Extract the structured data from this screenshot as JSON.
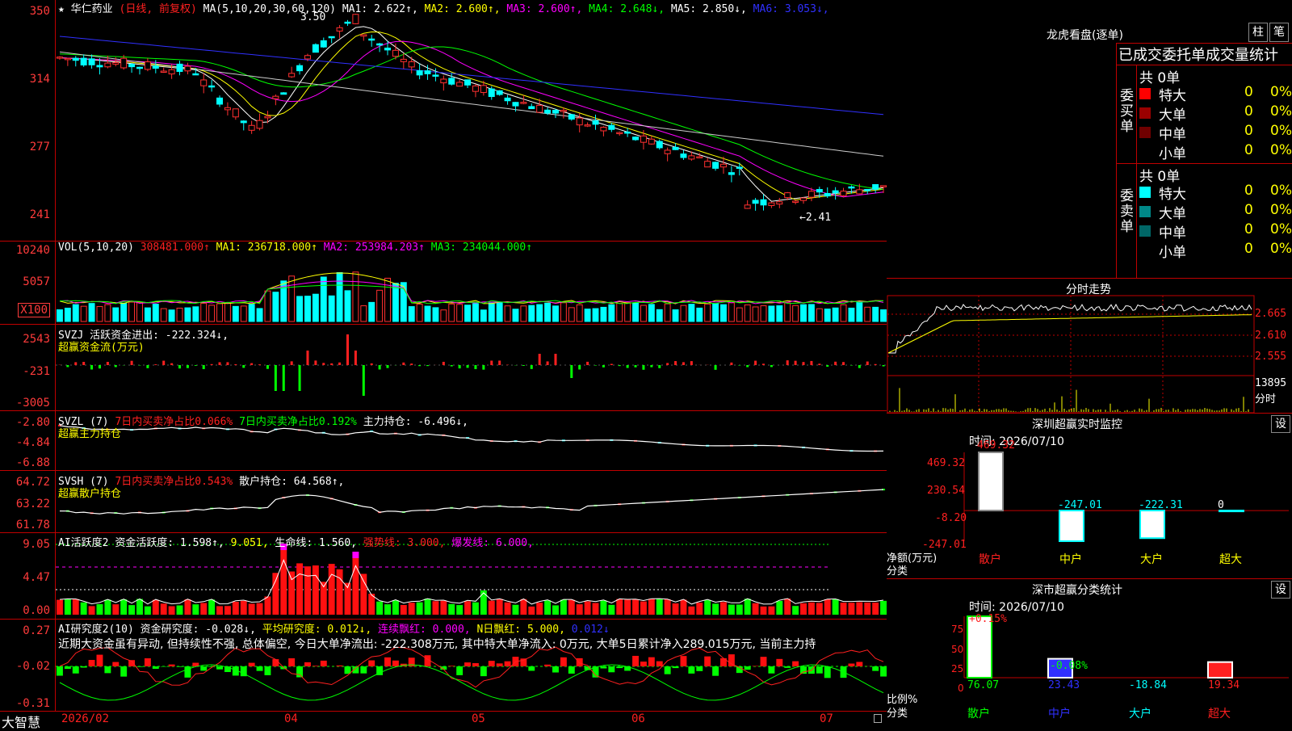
{
  "app_logo": "大智慧",
  "stock": {
    "name": "华仁药业",
    "mode": "(日线, 前复权)"
  },
  "main": {
    "ma_label": "MA(5,10,20,30,60,120)",
    "ma_values": [
      {
        "label": "MA1:",
        "value": "2.622",
        "arrow": "↑",
        "color": "#ffffff"
      },
      {
        "label": "MA2:",
        "value": "2.600",
        "arrow": "↑",
        "color": "#ffff00"
      },
      {
        "label": "MA3:",
        "value": "2.600",
        "arrow": "↑",
        "color": "#ff00ff"
      },
      {
        "label": "MA4:",
        "value": "2.648",
        "arrow": "↓",
        "color": "#00ff00"
      },
      {
        "label": "MA5:",
        "value": "2.850",
        "arrow": "↓",
        "color": "#ffffff"
      },
      {
        "label": "MA6:",
        "value": "3.053",
        "arrow": "↓",
        "color": "#3030ff"
      }
    ],
    "y_ticks": [
      "350",
      "314",
      "277",
      "241"
    ],
    "high_marker": "3.50",
    "low_marker": "←2.41"
  },
  "vol": {
    "label": "VOL(5,10,20)",
    "value": "308481.000↑",
    "ma1": "MA1: 236718.000↑",
    "ma2": "MA2: 253984.203↑",
    "ma3": "MA3: 234044.000↑",
    "y_ticks": [
      "10240",
      "5057",
      "X100"
    ]
  },
  "svzj": {
    "label": "SVZJ",
    "text": "活跃资金进出: -222.324↓,",
    "sub": "超赢资金流(万元)",
    "y_ticks": [
      "2543",
      "-231",
      "-3005"
    ]
  },
  "svzl": {
    "label": "SVZL (7)",
    "t1": "7日内买卖净占比0.066%",
    "t2": "7日内买卖净占比0.192%",
    "t3": "主力持仓: -6.496↓,",
    "sub": "超赢主力持仓",
    "y_ticks": [
      "-2.80",
      "-4.84",
      "-6.88"
    ]
  },
  "svsh": {
    "label": "SVSH (7)",
    "t1": "7日内买卖净占比0.543%",
    "t2": "散户持仓: 64.568↑,",
    "sub": "超赢散户持仓",
    "y_ticks": [
      "64.72",
      "63.22",
      "61.78"
    ]
  },
  "ai1": {
    "label": "AI活跃度2",
    "t1": "资金活跃度: 1.598↑,",
    "t2": "9.051,",
    "t3": "生命线: 1.560,",
    "t4": "强势线: 3.000,",
    "t5": "爆发线: 6.000,",
    "y_ticks": [
      "9.05",
      "4.47",
      "0.00"
    ]
  },
  "ai2": {
    "label": "AI研究度2(10)",
    "t1": "资金研究度: -0.028↓,",
    "t2": "平均研究度: 0.012↓,",
    "t3": "连续飘红: 0.000,",
    "t4": "N日飘红: 5.000,",
    "t5": "0.012↓",
    "comment": "近期大资金虽有异动, 但持续性不强, 总体偏空, 今日大单净流出: -222.308万元, 其中特大单净流入: 0万元, 大单5日累计净入289.015万元, 当前主力持",
    "y_ticks": [
      "0.27",
      "-0.02",
      "-0.31"
    ]
  },
  "xaxis": [
    "2026/02",
    "04",
    "05",
    "06",
    "07"
  ],
  "lhb": {
    "title": "龙虎看盘(逐单)",
    "btn1": "柱",
    "btn2": "笔",
    "subtitle": "已成交委托单成交量统计",
    "buy_label": "委买单",
    "sell_label": "委卖单",
    "buy_total": "共 0单",
    "sell_total": "共 0单",
    "buy_rows": [
      {
        "name": "特大",
        "count": "0",
        "pct": "0%",
        "color": "#ff0000"
      },
      {
        "name": "大单",
        "count": "0",
        "pct": "0%",
        "color": "#9a0000"
      },
      {
        "name": "中单",
        "count": "0",
        "pct": "0%",
        "color": "#700000"
      },
      {
        "name": "小单",
        "count": "0",
        "pct": "0%",
        "color": "#000000"
      }
    ],
    "sell_rows": [
      {
        "name": "特大",
        "count": "0",
        "pct": "0%",
        "color": "#00ffff"
      },
      {
        "name": "大单",
        "count": "0",
        "pct": "0%",
        "color": "#008888"
      },
      {
        "name": "中单",
        "count": "0",
        "pct": "0%",
        "color": "#006666"
      },
      {
        "name": "小单",
        "count": "0",
        "pct": "0%",
        "color": "#000000"
      }
    ]
  },
  "intraday": {
    "title": "分时走势",
    "y_ticks": [
      "2.665",
      "2.610",
      "2.555"
    ],
    "vol_tick": "13895",
    "vol_label": "分时"
  },
  "sz_monitor": {
    "title": "深圳超赢实时监控",
    "btn": "设",
    "time": "时间: 2026/07/10",
    "y_ticks": [
      "469.32",
      "230.54",
      "-8.20",
      "-247.01"
    ],
    "ylabel": "净额(万元)",
    "xlabel": "分类",
    "categories": [
      "散户",
      "中户",
      "大户",
      "超大"
    ],
    "values": [
      469.32,
      -247.01,
      -222.31,
      0
    ],
    "value_labels": [
      "469.32",
      "-247.01",
      "-222.31",
      "0"
    ]
  },
  "sz_class": {
    "title": "深市超赢分类统计",
    "btn": "设",
    "time": "时间: 2026/07/10",
    "y_ticks": [
      "75",
      "50",
      "25",
      "0"
    ],
    "ylabel": "比例%",
    "xlabel": "分类",
    "top_labels": [
      "+0.15%",
      "-0.08%"
    ],
    "categories": [
      "散户",
      "中户",
      "大户",
      "超大"
    ],
    "values": [
      76.07,
      23.43,
      -18.84,
      19.34
    ],
    "value_labels": [
      "76.07",
      "23.43",
      "-18.84",
      "19.34"
    ]
  }
}
